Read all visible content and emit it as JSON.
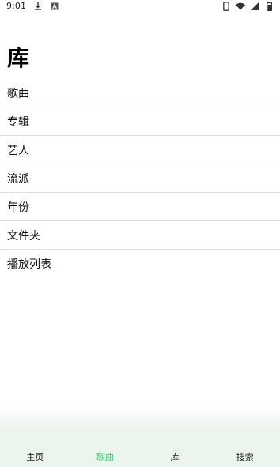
{
  "status_bar": {
    "time": "9:01",
    "left_icons": [
      "download-icon",
      "font-a-icon"
    ],
    "right_icons": [
      "vibrate-phone-icon",
      "wifi-icon",
      "cell-signal-icon",
      "battery-icon"
    ]
  },
  "page": {
    "title": "库"
  },
  "library_items": [
    {
      "label": "歌曲"
    },
    {
      "label": "专辑"
    },
    {
      "label": "艺人"
    },
    {
      "label": "流派"
    },
    {
      "label": "年份"
    },
    {
      "label": "文件夹"
    },
    {
      "label": "播放列表"
    }
  ],
  "bottom_nav": {
    "active_index": 1,
    "active_color": "#2ecc71",
    "background": "#ecf4ee",
    "items": [
      {
        "label": "主页"
      },
      {
        "label": "歌曲"
      },
      {
        "label": "库"
      },
      {
        "label": "搜索"
      }
    ]
  }
}
